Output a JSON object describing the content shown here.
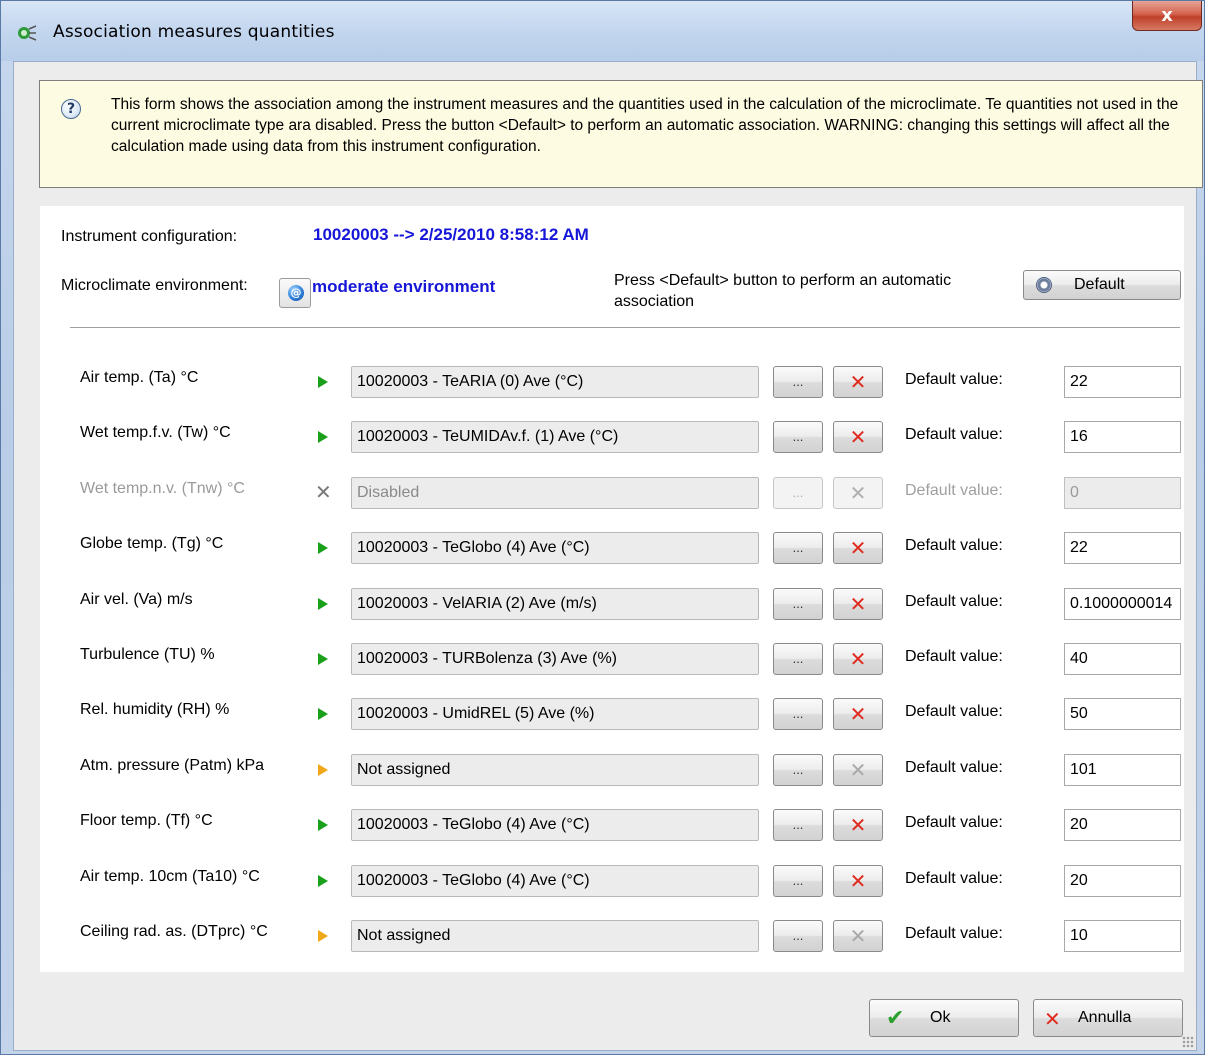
{
  "window": {
    "title": "Association measures quantities",
    "close_label": "x"
  },
  "info": {
    "icon": "question-icon",
    "text": "This form shows the association among the instrument measures and the quantities used in the calculation of the microclimate. Te quantities not used in the current microclimate type ara disabled. Press the button <Default> to perform an automatic association. WARNING: changing this settings will affect all the calculation made using data from this instrument configuration."
  },
  "config": {
    "label": "Instrument configuration:",
    "value": "10020003 --> 2/25/2010 8:58:12 AM"
  },
  "environment": {
    "label": "Microclimate environment:",
    "value": "moderate environment"
  },
  "default_hint": "Press <Default> button to perform an automatic association",
  "default_button": "Default",
  "default_value_label": "Default value:",
  "browse_label": "...",
  "rows": [
    {
      "label": "Air temp. (Ta) °C",
      "status": "assigned",
      "source": "10020003 - TeARIA (0) Ave (°C)",
      "default": "22"
    },
    {
      "label": "Wet temp.f.v. (Tw) °C",
      "status": "assigned",
      "source": "10020003 - TeUMIDAv.f. (1) Ave (°C)",
      "default": "16"
    },
    {
      "label": "Wet temp.n.v. (Tnw) °C",
      "status": "disabled",
      "source": "Disabled",
      "default": "0"
    },
    {
      "label": "Globe temp. (Tg) °C",
      "status": "assigned",
      "source": "10020003 - TeGlobo (4) Ave (°C)",
      "default": "22"
    },
    {
      "label": "Air vel. (Va) m/s",
      "status": "assigned",
      "source": "10020003 - VelARIA (2) Ave (m/s)",
      "default": "0.1000000014"
    },
    {
      "label": "Turbulence (TU) %",
      "status": "assigned",
      "source": "10020003 - TURBolenza (3) Ave (%)",
      "default": "40"
    },
    {
      "label": "Rel. humidity (RH) %",
      "status": "assigned",
      "source": "10020003 - UmidREL (5) Ave (%)",
      "default": "50"
    },
    {
      "label": "Atm. pressure (Patm) kPa",
      "status": "unassigned",
      "source": "Not assigned",
      "default": "101"
    },
    {
      "label": "Floor temp. (Tf) °C",
      "status": "assigned",
      "source": "10020003 - TeGlobo (4) Ave (°C)",
      "default": "20"
    },
    {
      "label": "Air temp. 10cm (Ta10) °C",
      "status": "assigned",
      "source": "10020003 - TeGlobo (4) Ave (°C)",
      "default": "20"
    },
    {
      "label": "Ceiling rad. as. (DTprc) °C",
      "status": "unassigned",
      "source": "Not assigned",
      "default": "10"
    }
  ],
  "buttons": {
    "ok": "Ok",
    "cancel": "Annulla"
  },
  "colors": {
    "accent_blue": "#1616d8",
    "assigned": "#1aa01a",
    "unassigned": "#f0a818",
    "clear_red": "#e02a20",
    "info_bg": "#fdfbe1"
  }
}
